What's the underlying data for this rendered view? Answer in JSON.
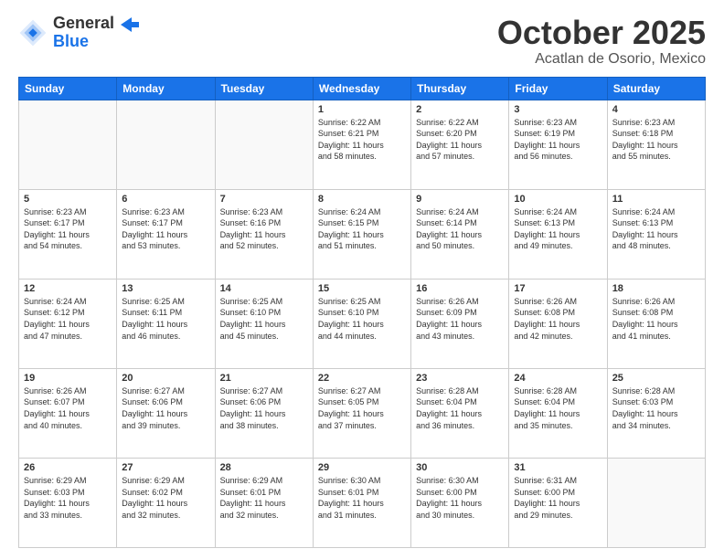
{
  "logo": {
    "general": "General",
    "blue": "Blue"
  },
  "header": {
    "month": "October 2025",
    "location": "Acatlan de Osorio, Mexico"
  },
  "weekdays": [
    "Sunday",
    "Monday",
    "Tuesday",
    "Wednesday",
    "Thursday",
    "Friday",
    "Saturday"
  ],
  "weeks": [
    [
      {
        "day": "",
        "info": ""
      },
      {
        "day": "",
        "info": ""
      },
      {
        "day": "",
        "info": ""
      },
      {
        "day": "1",
        "info": "Sunrise: 6:22 AM\nSunset: 6:21 PM\nDaylight: 11 hours\nand 58 minutes."
      },
      {
        "day": "2",
        "info": "Sunrise: 6:22 AM\nSunset: 6:20 PM\nDaylight: 11 hours\nand 57 minutes."
      },
      {
        "day": "3",
        "info": "Sunrise: 6:23 AM\nSunset: 6:19 PM\nDaylight: 11 hours\nand 56 minutes."
      },
      {
        "day": "4",
        "info": "Sunrise: 6:23 AM\nSunset: 6:18 PM\nDaylight: 11 hours\nand 55 minutes."
      }
    ],
    [
      {
        "day": "5",
        "info": "Sunrise: 6:23 AM\nSunset: 6:17 PM\nDaylight: 11 hours\nand 54 minutes."
      },
      {
        "day": "6",
        "info": "Sunrise: 6:23 AM\nSunset: 6:17 PM\nDaylight: 11 hours\nand 53 minutes."
      },
      {
        "day": "7",
        "info": "Sunrise: 6:23 AM\nSunset: 6:16 PM\nDaylight: 11 hours\nand 52 minutes."
      },
      {
        "day": "8",
        "info": "Sunrise: 6:24 AM\nSunset: 6:15 PM\nDaylight: 11 hours\nand 51 minutes."
      },
      {
        "day": "9",
        "info": "Sunrise: 6:24 AM\nSunset: 6:14 PM\nDaylight: 11 hours\nand 50 minutes."
      },
      {
        "day": "10",
        "info": "Sunrise: 6:24 AM\nSunset: 6:13 PM\nDaylight: 11 hours\nand 49 minutes."
      },
      {
        "day": "11",
        "info": "Sunrise: 6:24 AM\nSunset: 6:13 PM\nDaylight: 11 hours\nand 48 minutes."
      }
    ],
    [
      {
        "day": "12",
        "info": "Sunrise: 6:24 AM\nSunset: 6:12 PM\nDaylight: 11 hours\nand 47 minutes."
      },
      {
        "day": "13",
        "info": "Sunrise: 6:25 AM\nSunset: 6:11 PM\nDaylight: 11 hours\nand 46 minutes."
      },
      {
        "day": "14",
        "info": "Sunrise: 6:25 AM\nSunset: 6:10 PM\nDaylight: 11 hours\nand 45 minutes."
      },
      {
        "day": "15",
        "info": "Sunrise: 6:25 AM\nSunset: 6:10 PM\nDaylight: 11 hours\nand 44 minutes."
      },
      {
        "day": "16",
        "info": "Sunrise: 6:26 AM\nSunset: 6:09 PM\nDaylight: 11 hours\nand 43 minutes."
      },
      {
        "day": "17",
        "info": "Sunrise: 6:26 AM\nSunset: 6:08 PM\nDaylight: 11 hours\nand 42 minutes."
      },
      {
        "day": "18",
        "info": "Sunrise: 6:26 AM\nSunset: 6:08 PM\nDaylight: 11 hours\nand 41 minutes."
      }
    ],
    [
      {
        "day": "19",
        "info": "Sunrise: 6:26 AM\nSunset: 6:07 PM\nDaylight: 11 hours\nand 40 minutes."
      },
      {
        "day": "20",
        "info": "Sunrise: 6:27 AM\nSunset: 6:06 PM\nDaylight: 11 hours\nand 39 minutes."
      },
      {
        "day": "21",
        "info": "Sunrise: 6:27 AM\nSunset: 6:06 PM\nDaylight: 11 hours\nand 38 minutes."
      },
      {
        "day": "22",
        "info": "Sunrise: 6:27 AM\nSunset: 6:05 PM\nDaylight: 11 hours\nand 37 minutes."
      },
      {
        "day": "23",
        "info": "Sunrise: 6:28 AM\nSunset: 6:04 PM\nDaylight: 11 hours\nand 36 minutes."
      },
      {
        "day": "24",
        "info": "Sunrise: 6:28 AM\nSunset: 6:04 PM\nDaylight: 11 hours\nand 35 minutes."
      },
      {
        "day": "25",
        "info": "Sunrise: 6:28 AM\nSunset: 6:03 PM\nDaylight: 11 hours\nand 34 minutes."
      }
    ],
    [
      {
        "day": "26",
        "info": "Sunrise: 6:29 AM\nSunset: 6:03 PM\nDaylight: 11 hours\nand 33 minutes."
      },
      {
        "day": "27",
        "info": "Sunrise: 6:29 AM\nSunset: 6:02 PM\nDaylight: 11 hours\nand 32 minutes."
      },
      {
        "day": "28",
        "info": "Sunrise: 6:29 AM\nSunset: 6:01 PM\nDaylight: 11 hours\nand 32 minutes."
      },
      {
        "day": "29",
        "info": "Sunrise: 6:30 AM\nSunset: 6:01 PM\nDaylight: 11 hours\nand 31 minutes."
      },
      {
        "day": "30",
        "info": "Sunrise: 6:30 AM\nSunset: 6:00 PM\nDaylight: 11 hours\nand 30 minutes."
      },
      {
        "day": "31",
        "info": "Sunrise: 6:31 AM\nSunset: 6:00 PM\nDaylight: 11 hours\nand 29 minutes."
      },
      {
        "day": "",
        "info": ""
      }
    ]
  ]
}
